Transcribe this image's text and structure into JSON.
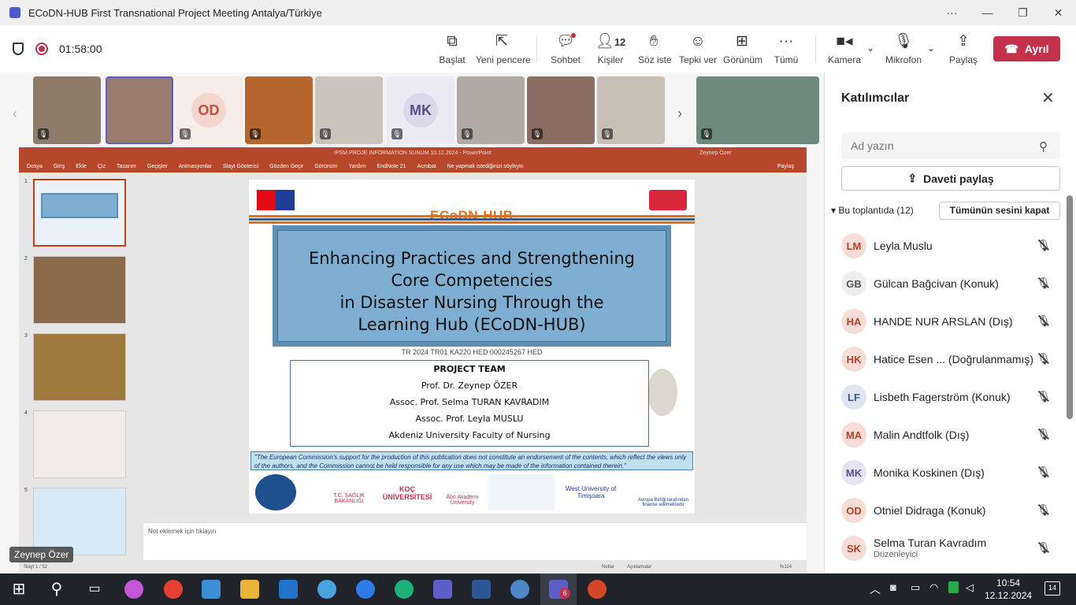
{
  "window": {
    "title": "ECoDN-HUB First Transnational Project Meeting Antalya/Türkiye",
    "more": "···",
    "minimize": "—",
    "maximize": "❐",
    "close": "✕"
  },
  "toolbar": {
    "timer": "01:58:00",
    "buttons": [
      {
        "label": "Başlat",
        "icon": "present-icon"
      },
      {
        "label": "Yeni pencere",
        "icon": "new-window-icon"
      },
      {
        "label": "Sohbet",
        "icon": "chat-icon"
      },
      {
        "label": "Kişiler",
        "icon": "people-icon",
        "count": "12"
      },
      {
        "label": "Söz iste",
        "icon": "raise-hand-icon"
      },
      {
        "label": "Tepki ver",
        "icon": "react-icon"
      },
      {
        "label": "Görünüm",
        "icon": "view-icon"
      },
      {
        "label": "Tümü",
        "icon": "more-icon"
      },
      {
        "label": "Kamera",
        "icon": "camera-icon"
      },
      {
        "label": "Mikrofon",
        "icon": "mic-off-icon"
      },
      {
        "label": "Paylaş",
        "icon": "share-icon"
      }
    ],
    "leave": "Ayrıl"
  },
  "video_strip": {
    "tiles": [
      {
        "initials": ""
      },
      {
        "initials": ""
      },
      {
        "initials": "OD"
      },
      {
        "initials": ""
      },
      {
        "initials": ""
      },
      {
        "initials": "MK"
      },
      {
        "initials": ""
      },
      {
        "initials": ""
      },
      {
        "initials": ""
      },
      {
        "initials": ""
      }
    ]
  },
  "presentation": {
    "app_title": "IPSM PROJE INFORMATION SUNUM 10.12.2024 - PowerPoint",
    "user": "Zeynep Özer",
    "menu": [
      "Dosya",
      "Giriş",
      "Ekle",
      "Çiz",
      "Tasarım",
      "Geçişler",
      "Animasyonlar",
      "Slayt Gösterisi",
      "Gözden Geçir",
      "Görünüm",
      "Yardım",
      "EndNote 21",
      "Acrobat",
      "Ne yapmak istediğinizi söyleyin"
    ],
    "share": "Paylaş",
    "thumbnails": [
      "1",
      "2",
      "3",
      "4",
      "5"
    ],
    "notes_placeholder": "Not eklemek için tıklayın",
    "status_left": "Slayt 1 / 52",
    "status_right": [
      "Notlar",
      "Açıklamalar",
      "%114"
    ],
    "presenter": "Zeynep Özer",
    "slide": {
      "brand": "ECoDN-HUB",
      "title_lines": [
        "Enhancing Practices and Strengthening",
        "Core Competencies",
        "in Disaster Nursing Through the",
        "Learning Hub (ECoDN-HUB)"
      ],
      "grant": "TR 2024 TR01 KA220 HED 000245267 HED",
      "team": [
        "PROJECT TEAM",
        "Prof. Dr. Zeynep ÖZER",
        "Assoc. Prof. Selma TURAN KAVRADIM",
        "Assoc. Prof. Leyla MUSLU",
        "Akdeniz University Faculty of Nursing"
      ],
      "disclaimer": "\"The European Commission's support for the production of this publication does not constitute an endorsement of the contents, which reflect the views only of the authors, and the Commission cannot be held responsible for any use which may be made of the information contained therein.\"",
      "partners": [
        "T.C. SAĞLIK BAKANLIĞI",
        "KOÇ ÜNİVERSİTESİ",
        "Åbo Akademi University",
        "West University of Timişoara",
        "Avrupa Birliği tarafından finanse edilmektedir"
      ]
    }
  },
  "panel": {
    "title": "Katılımcılar",
    "search_placeholder": "Ad yazın",
    "invite": "Daveti paylaş",
    "section": "Bu toplantıda (12)",
    "mute_all": "Tümünün sesini kapat",
    "participants": [
      {
        "initials": "LM",
        "name": "Leyla Muslu",
        "sub": "",
        "color": "#f8dcd6",
        "fg": "#b3412d"
      },
      {
        "initials": "GB",
        "name": "Gülcan Bağcivan (Konuk)",
        "sub": "",
        "color": "#eeeeee",
        "fg": "#555555"
      },
      {
        "initials": "HA",
        "name": "HANDE NUR ARSLAN (Dış)",
        "sub": "",
        "color": "#f8dcd6",
        "fg": "#b3412d"
      },
      {
        "initials": "HK",
        "name": "Hatice Esen ...  (Doğrulanmamış)",
        "sub": "",
        "color": "#f8dcd6",
        "fg": "#b3412d"
      },
      {
        "initials": "LF",
        "name": "Lisbeth Fagerström (Konuk)",
        "sub": "",
        "color": "#dde6f2",
        "fg": "#3a5a85"
      },
      {
        "initials": "MA",
        "name": "Malin Andtfolk (Dış)",
        "sub": "",
        "color": "#f8dcd6",
        "fg": "#b3412d"
      },
      {
        "initials": "MK",
        "name": "Monika Koskinen (Dış)",
        "sub": "",
        "color": "#e6e3f2",
        "fg": "#5a4f8a"
      },
      {
        "initials": "OD",
        "name": "Otniel Didraga (Konuk)",
        "sub": "",
        "color": "#f8dcd6",
        "fg": "#b3412d"
      },
      {
        "initials": "SK",
        "name": "Selma Turan Kavradım",
        "sub": "Düzenleyici",
        "color": "#f8dcd6",
        "fg": "#b3412d"
      }
    ]
  },
  "taskbar": {
    "time": "10:54",
    "date": "12.12.2024",
    "notifications": "14",
    "teams_badge": "6"
  }
}
